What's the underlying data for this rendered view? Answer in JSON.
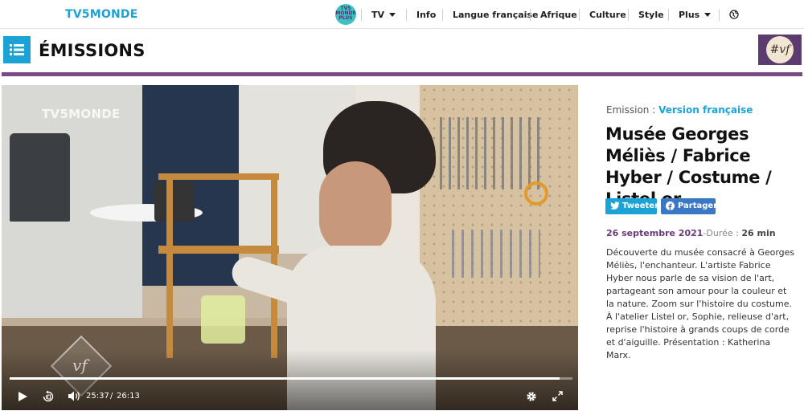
{
  "nav": {
    "logo": "TV5MONDE",
    "kids_logo": "TV5 MONDE PLUS",
    "items": [
      {
        "label": "TV",
        "has_caret": true
      },
      {
        "label": "Info",
        "has_caret": false
      },
      {
        "label": "Langue française",
        "has_caret": false
      },
      {
        "label": "Afrique",
        "has_caret": false
      },
      {
        "label": "Culture",
        "has_caret": false
      },
      {
        "label": "Style",
        "has_caret": false
      },
      {
        "label": "Plus",
        "has_caret": true
      }
    ],
    "globe_icon": "globe-icon"
  },
  "section": {
    "title": "ÉMISSIONS",
    "menu_icon": "list-icon",
    "badge": "#vf",
    "accent_color": "#1ba3d6",
    "rule_color": "#7a4a86"
  },
  "video": {
    "watermark": "TV5MONDE",
    "corner_mark": "vf",
    "current_time": "25:37",
    "duration": "26:13",
    "progress": 0.977,
    "controls": [
      "play-icon",
      "replay-10-icon",
      "volume-icon",
      "settings-icon",
      "fullscreen-icon"
    ]
  },
  "article": {
    "meta_prefix": "Emission : ",
    "show_name": "Version française",
    "title": "Musée Georges Méliès / Fabrice Hyber / Costume / Listel or",
    "share": {
      "tweet": "Tweeter",
      "facebook": "Partager"
    },
    "date": "26 septembre 2021",
    "duration_label": "-Durée : ",
    "duration": "26 min",
    "description": "Découverte du musée consacré à Georges Méliès, l'enchanteur. L'artiste Fabrice Hyber nous parle de sa vision de l'art, partageant son amour pour la couleur et la nature. Zoom sur l'histoire du costume. À l'atelier Listel or, Sophie, relieuse d'art, reprise l'histoire à grands coups de corde et d'aiguille. Présentation : Katherina Marx."
  }
}
